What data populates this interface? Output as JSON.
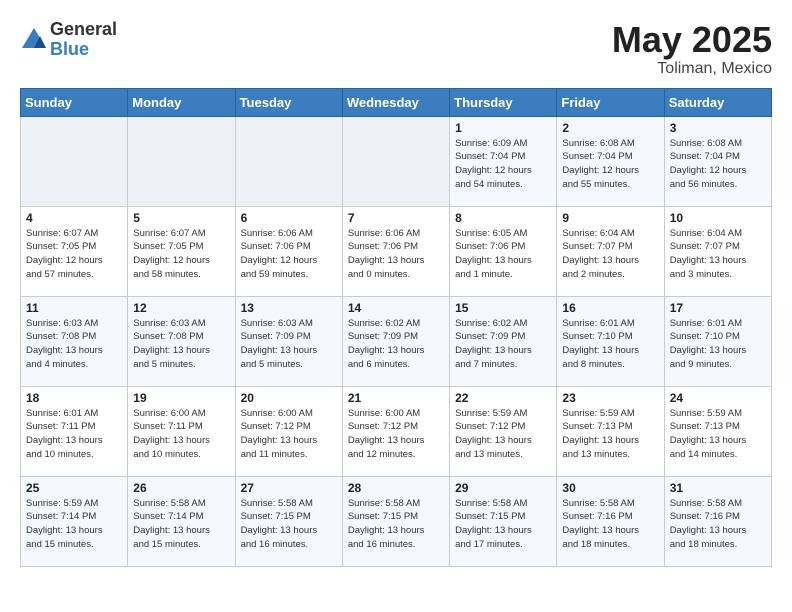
{
  "header": {
    "logo_general": "General",
    "logo_blue": "Blue",
    "month_title": "May 2025",
    "location": "Toliman, Mexico"
  },
  "days_of_week": [
    "Sunday",
    "Monday",
    "Tuesday",
    "Wednesday",
    "Thursday",
    "Friday",
    "Saturday"
  ],
  "weeks": [
    [
      {
        "day": "",
        "info": ""
      },
      {
        "day": "",
        "info": ""
      },
      {
        "day": "",
        "info": ""
      },
      {
        "day": "",
        "info": ""
      },
      {
        "day": "1",
        "info": "Sunrise: 6:09 AM\nSunset: 7:04 PM\nDaylight: 12 hours\nand 54 minutes."
      },
      {
        "day": "2",
        "info": "Sunrise: 6:08 AM\nSunset: 7:04 PM\nDaylight: 12 hours\nand 55 minutes."
      },
      {
        "day": "3",
        "info": "Sunrise: 6:08 AM\nSunset: 7:04 PM\nDaylight: 12 hours\nand 56 minutes."
      }
    ],
    [
      {
        "day": "4",
        "info": "Sunrise: 6:07 AM\nSunset: 7:05 PM\nDaylight: 12 hours\nand 57 minutes."
      },
      {
        "day": "5",
        "info": "Sunrise: 6:07 AM\nSunset: 7:05 PM\nDaylight: 12 hours\nand 58 minutes."
      },
      {
        "day": "6",
        "info": "Sunrise: 6:06 AM\nSunset: 7:06 PM\nDaylight: 12 hours\nand 59 minutes."
      },
      {
        "day": "7",
        "info": "Sunrise: 6:06 AM\nSunset: 7:06 PM\nDaylight: 13 hours\nand 0 minutes."
      },
      {
        "day": "8",
        "info": "Sunrise: 6:05 AM\nSunset: 7:06 PM\nDaylight: 13 hours\nand 1 minute."
      },
      {
        "day": "9",
        "info": "Sunrise: 6:04 AM\nSunset: 7:07 PM\nDaylight: 13 hours\nand 2 minutes."
      },
      {
        "day": "10",
        "info": "Sunrise: 6:04 AM\nSunset: 7:07 PM\nDaylight: 13 hours\nand 3 minutes."
      }
    ],
    [
      {
        "day": "11",
        "info": "Sunrise: 6:03 AM\nSunset: 7:08 PM\nDaylight: 13 hours\nand 4 minutes."
      },
      {
        "day": "12",
        "info": "Sunrise: 6:03 AM\nSunset: 7:08 PM\nDaylight: 13 hours\nand 5 minutes."
      },
      {
        "day": "13",
        "info": "Sunrise: 6:03 AM\nSunset: 7:09 PM\nDaylight: 13 hours\nand 5 minutes."
      },
      {
        "day": "14",
        "info": "Sunrise: 6:02 AM\nSunset: 7:09 PM\nDaylight: 13 hours\nand 6 minutes."
      },
      {
        "day": "15",
        "info": "Sunrise: 6:02 AM\nSunset: 7:09 PM\nDaylight: 13 hours\nand 7 minutes."
      },
      {
        "day": "16",
        "info": "Sunrise: 6:01 AM\nSunset: 7:10 PM\nDaylight: 13 hours\nand 8 minutes."
      },
      {
        "day": "17",
        "info": "Sunrise: 6:01 AM\nSunset: 7:10 PM\nDaylight: 13 hours\nand 9 minutes."
      }
    ],
    [
      {
        "day": "18",
        "info": "Sunrise: 6:01 AM\nSunset: 7:11 PM\nDaylight: 13 hours\nand 10 minutes."
      },
      {
        "day": "19",
        "info": "Sunrise: 6:00 AM\nSunset: 7:11 PM\nDaylight: 13 hours\nand 10 minutes."
      },
      {
        "day": "20",
        "info": "Sunrise: 6:00 AM\nSunset: 7:12 PM\nDaylight: 13 hours\nand 11 minutes."
      },
      {
        "day": "21",
        "info": "Sunrise: 6:00 AM\nSunset: 7:12 PM\nDaylight: 13 hours\nand 12 minutes."
      },
      {
        "day": "22",
        "info": "Sunrise: 5:59 AM\nSunset: 7:12 PM\nDaylight: 13 hours\nand 13 minutes."
      },
      {
        "day": "23",
        "info": "Sunrise: 5:59 AM\nSunset: 7:13 PM\nDaylight: 13 hours\nand 13 minutes."
      },
      {
        "day": "24",
        "info": "Sunrise: 5:59 AM\nSunset: 7:13 PM\nDaylight: 13 hours\nand 14 minutes."
      }
    ],
    [
      {
        "day": "25",
        "info": "Sunrise: 5:59 AM\nSunset: 7:14 PM\nDaylight: 13 hours\nand 15 minutes."
      },
      {
        "day": "26",
        "info": "Sunrise: 5:58 AM\nSunset: 7:14 PM\nDaylight: 13 hours\nand 15 minutes."
      },
      {
        "day": "27",
        "info": "Sunrise: 5:58 AM\nSunset: 7:15 PM\nDaylight: 13 hours\nand 16 minutes."
      },
      {
        "day": "28",
        "info": "Sunrise: 5:58 AM\nSunset: 7:15 PM\nDaylight: 13 hours\nand 16 minutes."
      },
      {
        "day": "29",
        "info": "Sunrise: 5:58 AM\nSunset: 7:15 PM\nDaylight: 13 hours\nand 17 minutes."
      },
      {
        "day": "30",
        "info": "Sunrise: 5:58 AM\nSunset: 7:16 PM\nDaylight: 13 hours\nand 18 minutes."
      },
      {
        "day": "31",
        "info": "Sunrise: 5:58 AM\nSunset: 7:16 PM\nDaylight: 13 hours\nand 18 minutes."
      }
    ]
  ]
}
